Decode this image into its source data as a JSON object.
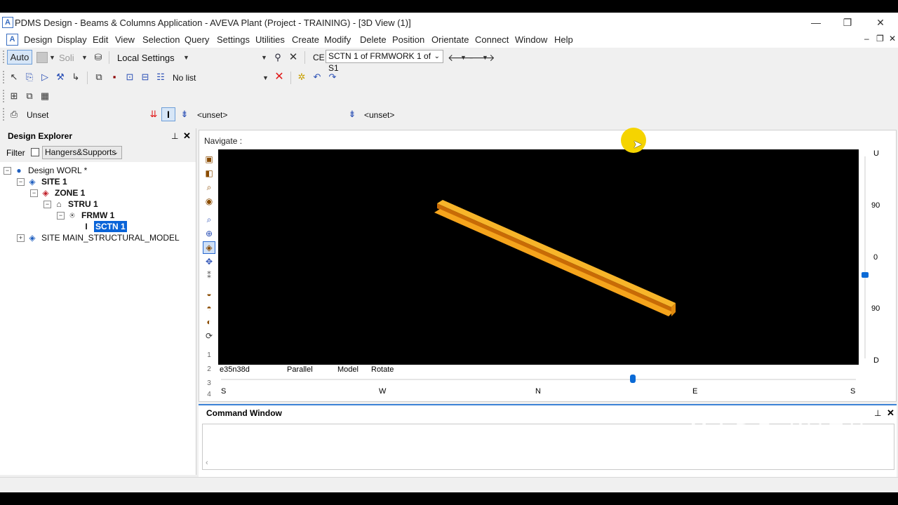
{
  "window": {
    "title": "PDMS Design - Beams & Columns Application - AVEVA Plant (Project - TRAINING) - [3D View (1)]",
    "app_icon": "A",
    "controls": {
      "minimize": "—",
      "restore": "❐",
      "close": "✕"
    }
  },
  "menubar": {
    "app_icon": "A",
    "items": [
      "Design",
      "Display",
      "Edit",
      "View",
      "Selection",
      "Query",
      "Settings",
      "Utilities",
      "Create",
      "Modify",
      "Delete",
      "Position",
      "Orientate",
      "Connect",
      "Window",
      "Help"
    ],
    "mdi": {
      "minimize": "–",
      "restore": "❐",
      "close": "✕"
    }
  },
  "toolbar1": {
    "auto_label": "Auto",
    "solid_label": "Soli",
    "local_settings": "Local Settings",
    "ce_label": "CE",
    "ce_value": "SCTN 1 of FRMWORK 1 of S1"
  },
  "toolbar2": {
    "list_value": "No list"
  },
  "toolbar4": {
    "left_value": "Unset",
    "unset1": "<unset>",
    "unset2": "<unset>"
  },
  "explorer": {
    "title": "Design Explorer",
    "filter_label": "Filter",
    "filter_value": "Hangers&Supports",
    "tree": [
      {
        "label": "Design WORL *",
        "icon": "globe-icon",
        "bold": false,
        "selected": false
      },
      {
        "label": "SITE 1",
        "icon": "site-icon",
        "bold": true,
        "selected": false
      },
      {
        "label": "ZONE 1",
        "icon": "zone-icon",
        "bold": true,
        "selected": false
      },
      {
        "label": "STRU 1",
        "icon": "structure-icon",
        "bold": true,
        "selected": false
      },
      {
        "label": "FRMW 1",
        "icon": "framework-icon",
        "bold": true,
        "selected": false
      },
      {
        "label": "SCTN 1",
        "icon": "section-icon",
        "bold": true,
        "selected": true
      },
      {
        "label": "SITE MAIN_STRUCTURAL_MODEL",
        "icon": "site-icon",
        "bold": false,
        "selected": false
      }
    ]
  },
  "view": {
    "navigate_label": "Navigate :",
    "status": {
      "direction": "e35n38d",
      "projection": "Parallel",
      "mode": "Model",
      "action": "Rotate"
    },
    "compass": [
      "S",
      "W",
      "N",
      "E",
      "S"
    ],
    "elevation": [
      "U",
      "90",
      "0",
      "90",
      "D"
    ],
    "beam_color": "#f5a41c",
    "background": "#000000",
    "side_labels": [
      "1",
      "2",
      "3",
      "4"
    ]
  },
  "command_window": {
    "title": "Command Window"
  },
  "watermark": {
    "line1": "MADE WITH",
    "line2": "ANIMOTICA"
  }
}
